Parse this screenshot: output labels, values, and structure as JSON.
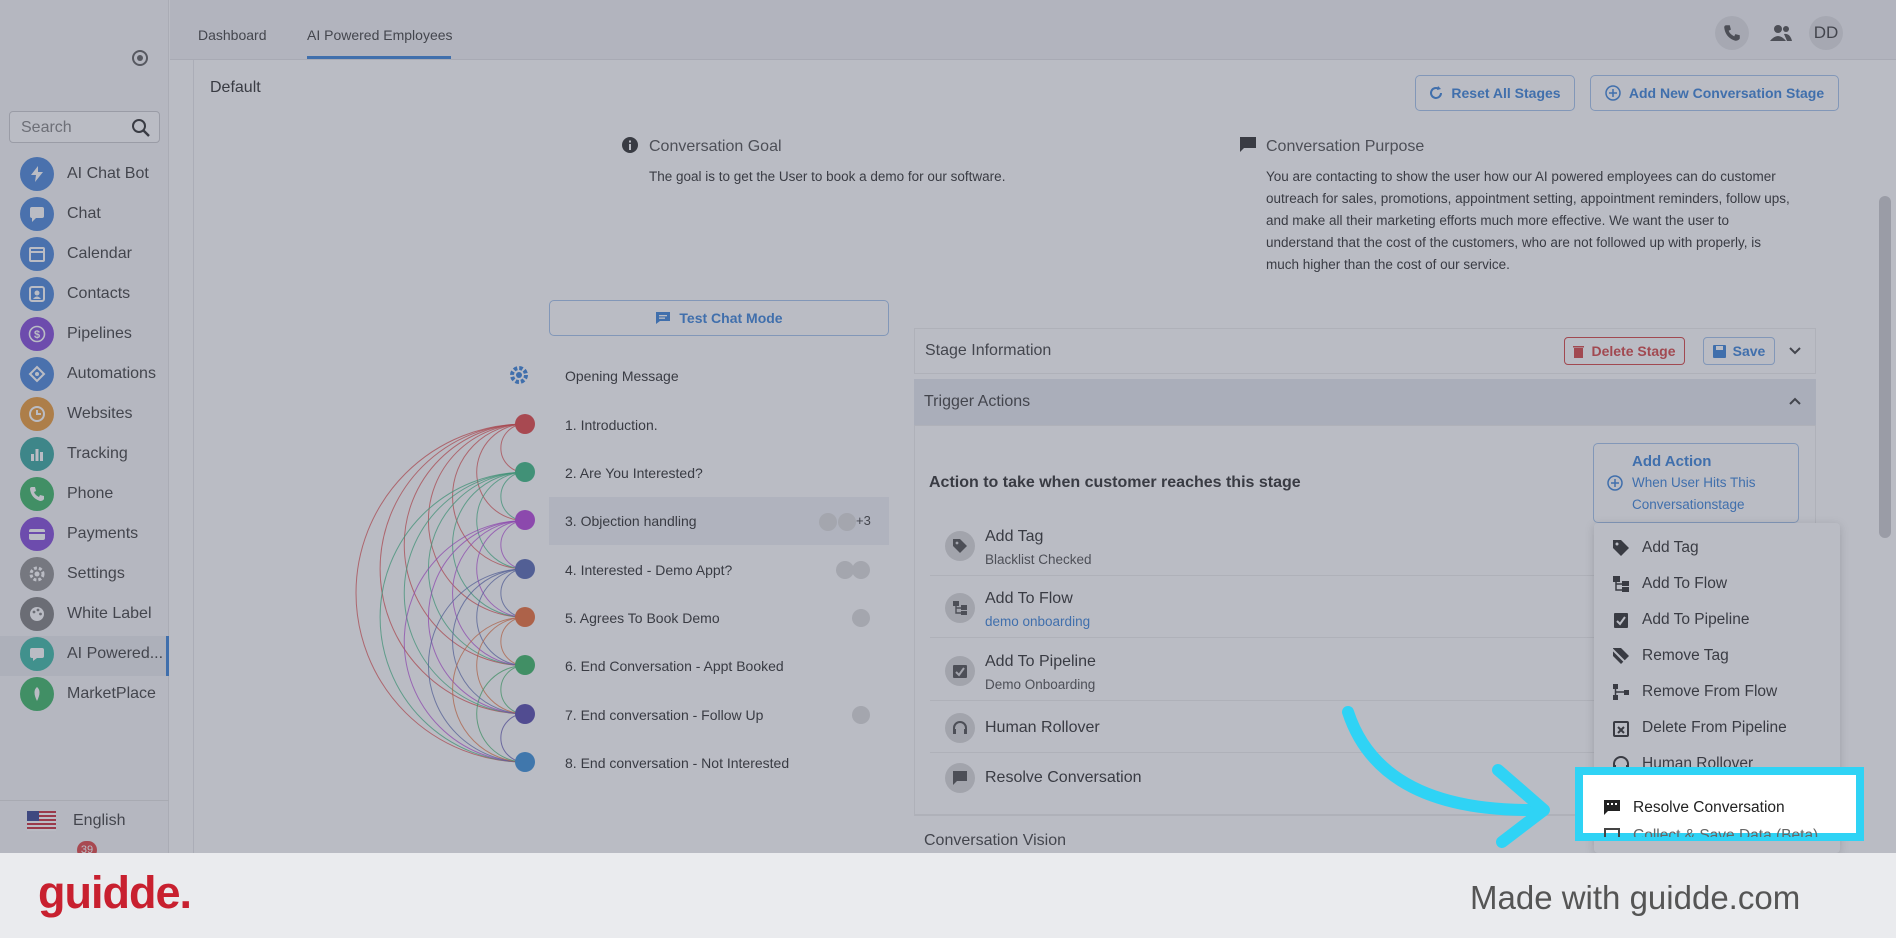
{
  "sidebar": {
    "search_placeholder": "Search",
    "items": [
      {
        "label": "AI Chat Bot",
        "icon": "bolt-icon",
        "color": "#3f7fd8"
      },
      {
        "label": "Chat",
        "icon": "chat-icon",
        "color": "#3f7fd8"
      },
      {
        "label": "Calendar",
        "icon": "calendar-icon",
        "color": "#3f7fd8"
      },
      {
        "label": "Contacts",
        "icon": "contacts-icon",
        "color": "#3f7fd8"
      },
      {
        "label": "Pipelines",
        "icon": "dollar-icon",
        "color": "#7a3fd8"
      },
      {
        "label": "Automations",
        "icon": "automation-icon",
        "color": "#3f7fd8"
      },
      {
        "label": "Websites",
        "icon": "globe-icon",
        "color": "#e8952c"
      },
      {
        "label": "Tracking",
        "icon": "chart-icon",
        "color": "#2aa39a"
      },
      {
        "label": "Phone",
        "icon": "phone-icon",
        "color": "#2fb25c"
      },
      {
        "label": "Payments",
        "icon": "card-icon",
        "color": "#7a3fd8"
      },
      {
        "label": "Settings",
        "icon": "gear-icon",
        "color": "#8a8a8a"
      },
      {
        "label": "White Label",
        "icon": "palette-icon",
        "color": "#777777"
      },
      {
        "label": "AI Powered...",
        "icon": "message-icon",
        "color": "#2fb5a0"
      },
      {
        "label": "MarketPlace",
        "icon": "marketplace-icon",
        "color": "#2fb25c"
      }
    ],
    "language": "English",
    "badge": "39"
  },
  "topbar": {
    "tabs": [
      "Dashboard",
      "AI Powered Employees"
    ],
    "avatar": "DD"
  },
  "main": {
    "section_title": "Default",
    "reset_label": "Reset All Stages",
    "add_stage_label": "Add New Conversation Stage",
    "goal_heading": "Conversation Goal",
    "goal_text": "The goal is to get the User to book a demo for our software.",
    "purpose_heading": "Conversation Purpose",
    "purpose_lines": [
      "You are contacting to show the user how our AI powered employees can do customer",
      "outreach for sales, promotions, appointment setting, appointment reminders, follow ups,",
      "and make all their marketing efforts much more effective. We want the user to",
      "understand that the cost of the customers, who are not followed up with properly, is",
      "much higher than the cost of our service."
    ],
    "test_chat_label": "Test Chat Mode",
    "opening_message": "Opening Message",
    "stages": [
      {
        "label": "1. Introduction.",
        "color": "#e03a3a"
      },
      {
        "label": "2. Are You Interested?",
        "color": "#2fb57a"
      },
      {
        "label": "3. Objection handling",
        "color": "#b03ad8"
      },
      {
        "label": "4. Interested - Demo Appt?",
        "color": "#4d5fae"
      },
      {
        "label": "5. Agrees To Book Demo",
        "color": "#e8652c"
      },
      {
        "label": "6. End Conversation - Appt Booked",
        "color": "#2fb25c"
      },
      {
        "label": "7. End conversation - Follow Up",
        "color": "#4a3fa8"
      },
      {
        "label": "8. End conversation - Not Interested",
        "color": "#2e88d6"
      }
    ],
    "stage3_count": "3",
    "stage_info_label": "Stage Information",
    "delete_stage_label": "Delete Stage",
    "save_label": "Save",
    "trigger_actions_label": "Trigger Actions",
    "action_prompt": "Action to take when customer reaches this stage",
    "add_action_title": "Add Action",
    "add_action_sub1": "When User Hits This",
    "add_action_sub2": "Conversationstage",
    "actions": [
      {
        "title": "Add Tag",
        "sub": "Blacklist Checked"
      },
      {
        "title": "Add To Flow",
        "sub": "demo onboarding"
      },
      {
        "title": "Add To Pipeline",
        "sub": "Demo Onboarding"
      },
      {
        "title": "Human Rollover",
        "sub": ""
      },
      {
        "title": "Resolve Conversation",
        "sub": ""
      }
    ],
    "vision_label": "Conversation Vision"
  },
  "dropdown": {
    "items": [
      "Add Tag",
      "Add To Flow",
      "Add To Pipeline",
      "Remove Tag",
      "Remove From Flow",
      "Delete From Pipeline",
      "Human Rollover",
      "Resolve Conversation",
      "Collect & Save Data (Beta)"
    ]
  },
  "footer": {
    "logo": "guidde.",
    "made_with": "Made with guidde.com"
  },
  "colors": {
    "accent": "#2e7bd6",
    "highlight": "#2fd3f5",
    "danger": "#d43a3a",
    "logo": "#c8202f"
  }
}
